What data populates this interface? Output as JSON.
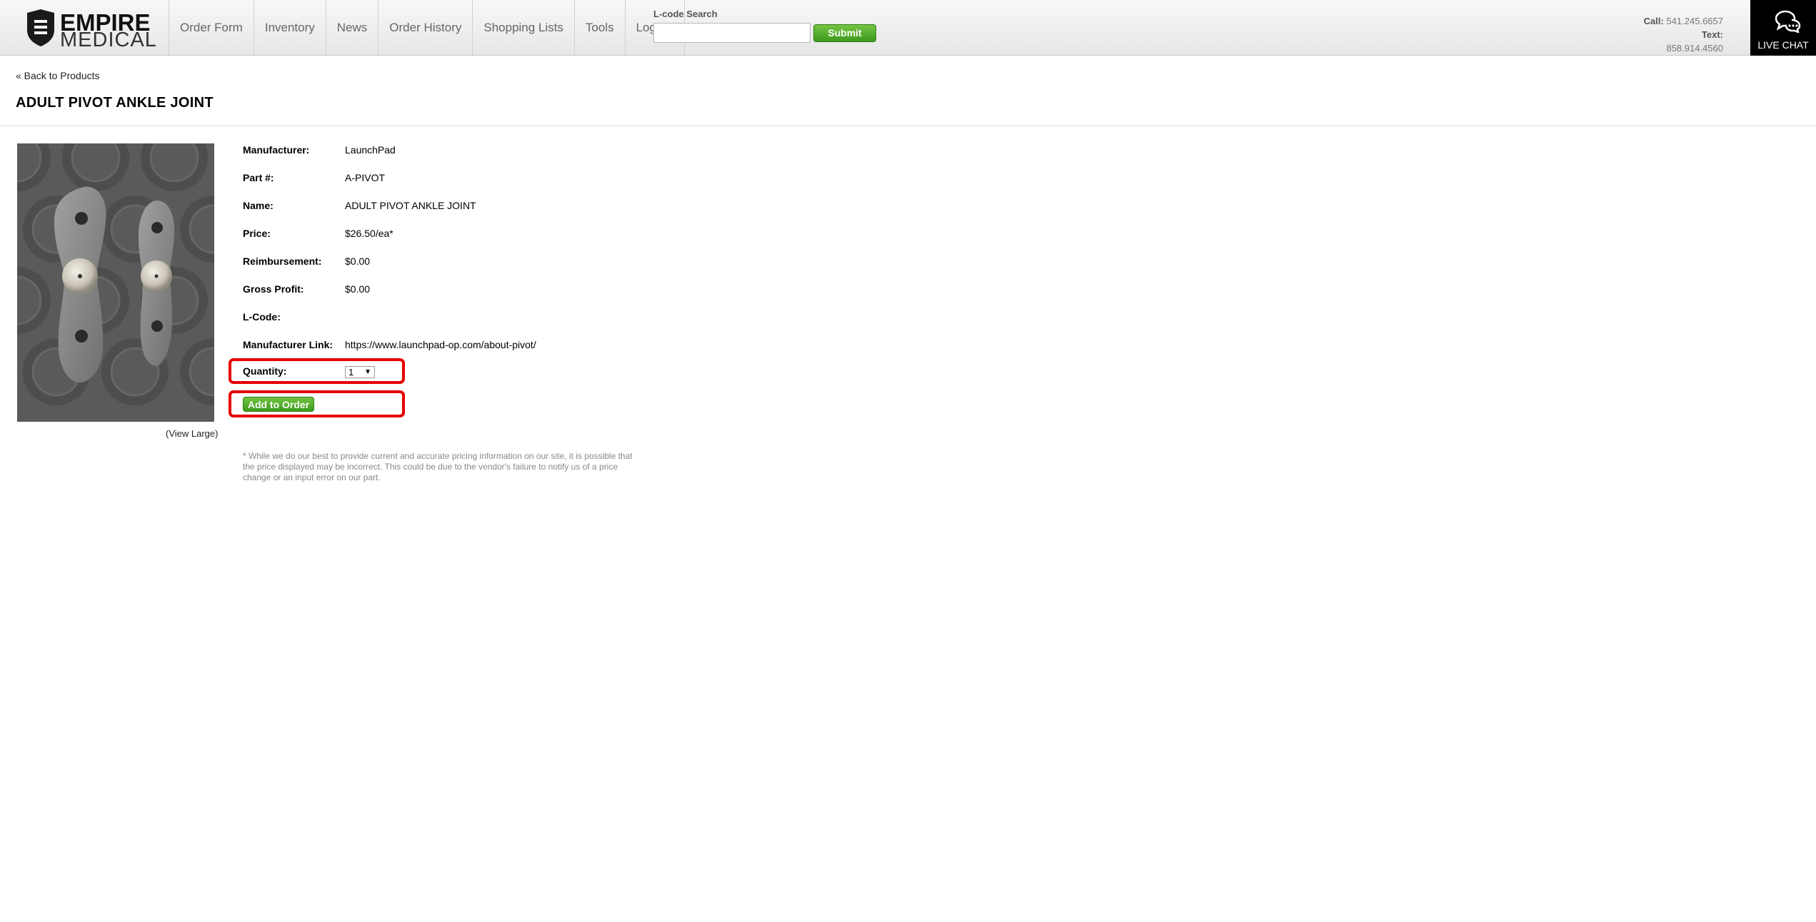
{
  "header": {
    "logo": {
      "line1": "EMPIRE",
      "line2": "MEDICAL"
    },
    "nav": [
      "Order Form",
      "Inventory",
      "News",
      "Order History",
      "Shopping Lists",
      "Tools",
      "Logout"
    ],
    "lcode_search": {
      "label": "L-code Search",
      "value": "",
      "submit_label": "Submit"
    },
    "contact": {
      "call_label": "Call:",
      "call_number": "541.245.6657",
      "text_label": "Text:",
      "text_number": "858.914.4560"
    },
    "live_chat_label": "LIVE CHAT"
  },
  "page": {
    "back_link": "« Back to Products",
    "title": "ADULT PIVOT ANKLE JOINT",
    "view_large": "(View Large)",
    "details": [
      {
        "label": "Manufacturer:",
        "value": "LaunchPad"
      },
      {
        "label": "Part #:",
        "value": "A-PIVOT"
      },
      {
        "label": "Name:",
        "value": "ADULT PIVOT ANKLE JOINT"
      },
      {
        "label": "Price:",
        "value": "$26.50/ea*"
      },
      {
        "label": "Reimbursement:",
        "value": "$0.00"
      },
      {
        "label": "Gross Profit:",
        "value": "$0.00"
      },
      {
        "label": "L-Code:",
        "value": ""
      },
      {
        "label": "Manufacturer Link:",
        "value": "https://www.launchpad-op.com/about-pivot/"
      }
    ],
    "quantity": {
      "label": "Quantity:",
      "value": "1"
    },
    "add_to_order_label": "Add to Order",
    "disclaimer": "* While we do our best to provide current and accurate pricing information on our site, it is possible that the price displayed may be incorrect. This could be due to the vendor's failure to notify us of a price change or an input error on our part."
  },
  "colors": {
    "button_green": "#4fae2c",
    "highlight_red": "#e60000",
    "live_chat_bg": "#000000"
  }
}
